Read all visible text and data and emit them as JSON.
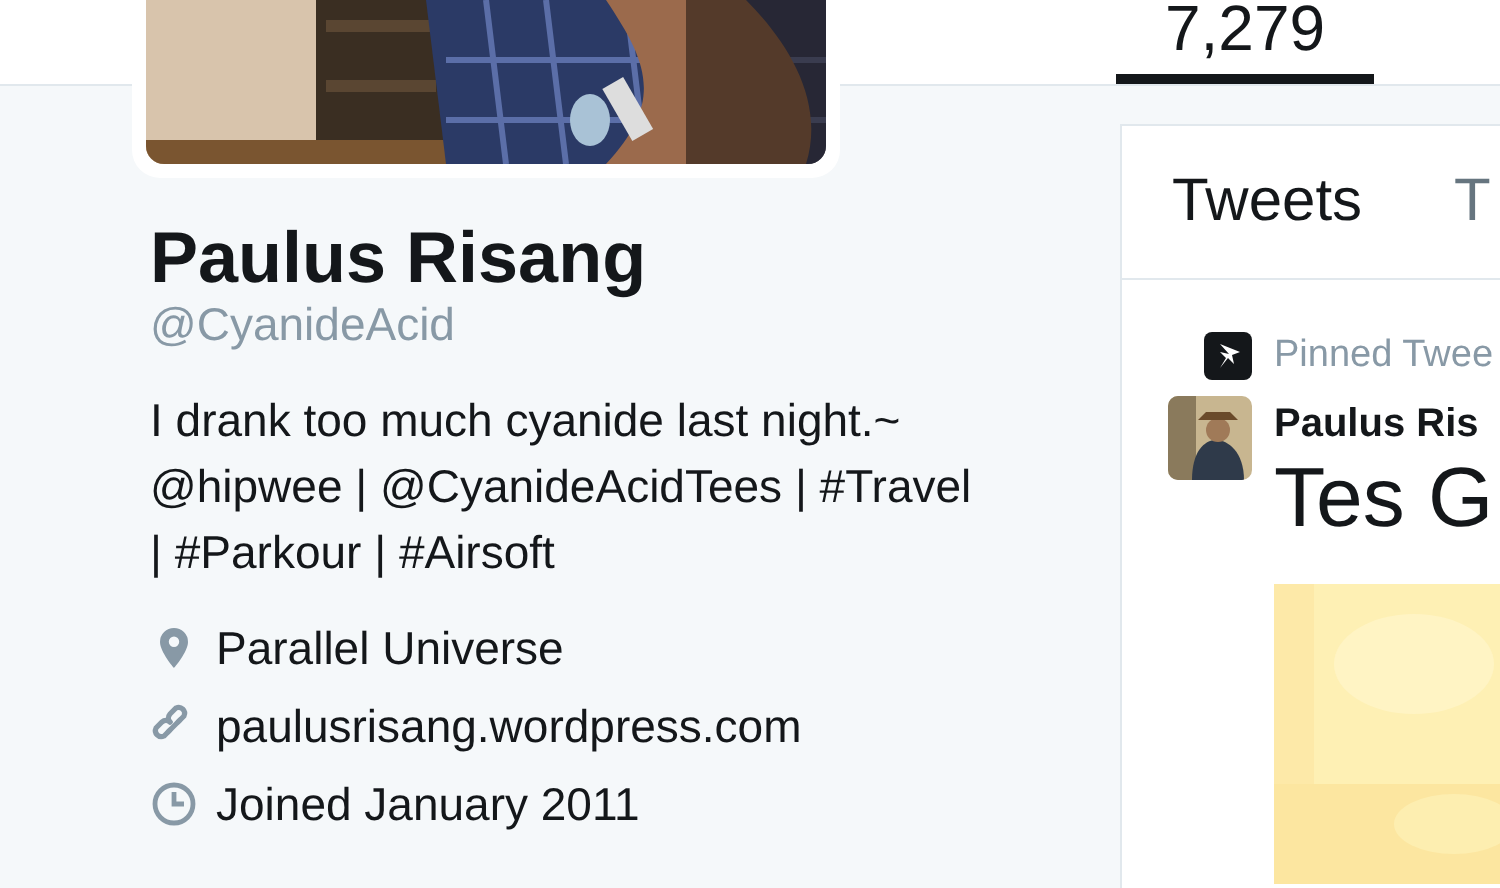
{
  "stats": [
    {
      "value": "7,279",
      "selected": true
    }
  ],
  "profile": {
    "name": "Paulus Risang",
    "handle": "@CyanideAcid",
    "bio": "I drank too much cyanide last night.~ @hipwee | @CyanideAcidTees | #Travel | #Parkour | #Airsoft",
    "details": [
      {
        "kind": "location",
        "text": "Parallel Universe"
      },
      {
        "kind": "link",
        "text": "paulusrisang.wordpress.com"
      },
      {
        "kind": "joined",
        "text": "Joined January 2011"
      }
    ]
  },
  "timeline": {
    "tabs": [
      {
        "label": "Tweets",
        "selected": true
      },
      {
        "label": "T",
        "selected": false
      }
    ],
    "pinned_tweet": {
      "context": "Pinned Twee",
      "author": "Paulus Ris",
      "text": "Tes G"
    }
  }
}
